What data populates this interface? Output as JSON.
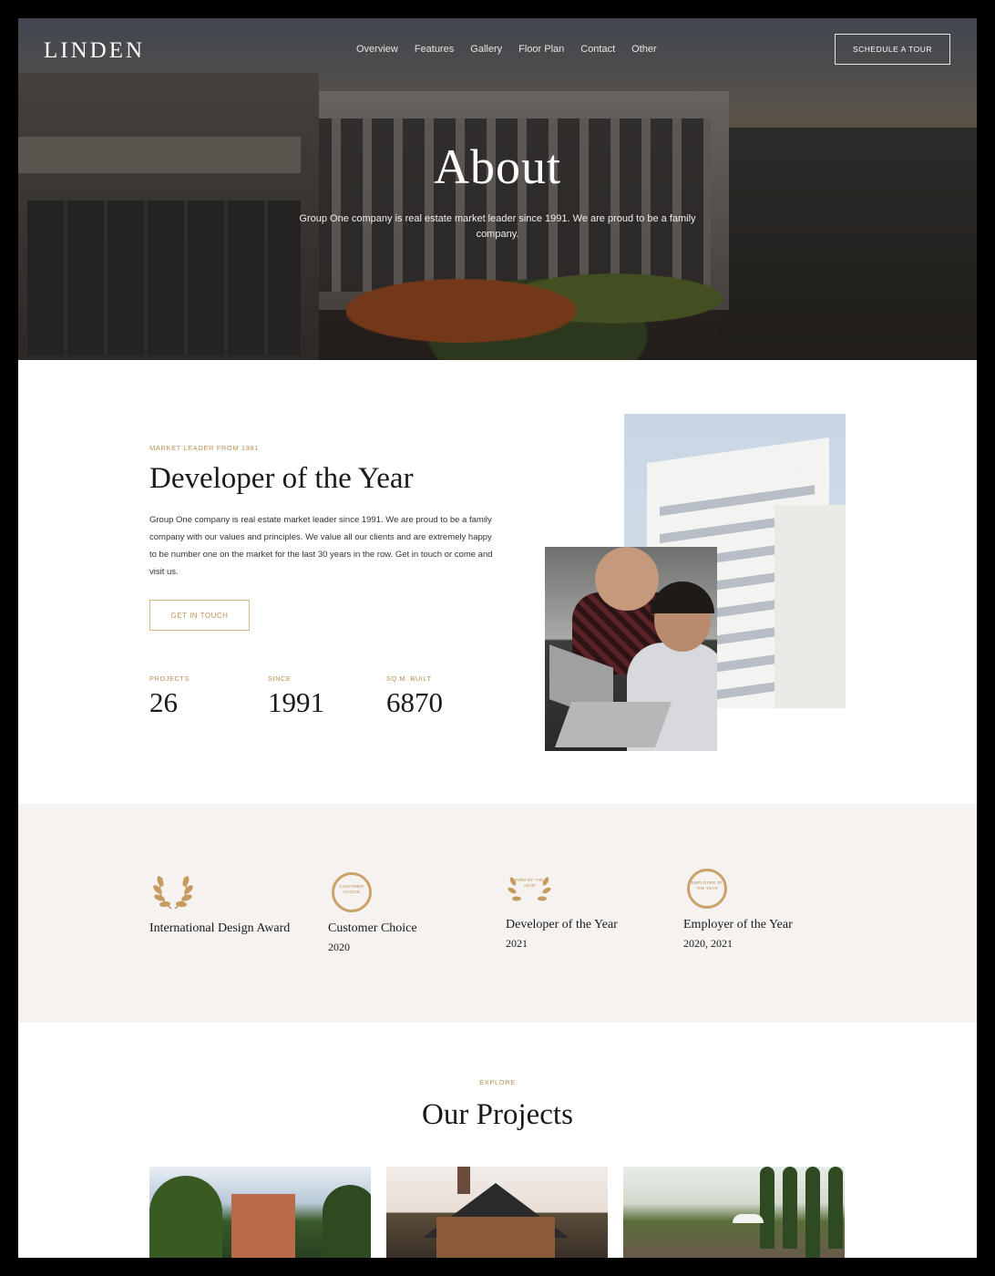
{
  "nav": {
    "logo": "LINDEN",
    "links": [
      "Overview",
      "Features",
      "Gallery",
      "Floor Plan",
      "Contact",
      "Other"
    ],
    "cta": "SCHEDULE A TOUR"
  },
  "hero": {
    "title": "About",
    "subtitle": "Group One company is real estate market leader since 1991. We are proud to be a family company."
  },
  "about": {
    "eyebrow": "MARKET LEADER FROM 1991",
    "title": "Developer of the Year",
    "text": "Group One company is real estate market leader since 1991. We are proud to be a family company with our values and principles. We value all our clients and are extremely happy to be number one on the market for the last 30 years in the row. Get in touch or come and visit us.",
    "button": "GET IN TOUCH",
    "stats": [
      {
        "label": "PROJECTS",
        "value": "26"
      },
      {
        "label": "SINCE",
        "value": "1991"
      },
      {
        "label": "SQ.M. BUILT",
        "value": "6870"
      }
    ]
  },
  "awards": [
    {
      "icon": "laurel-wreath-icon",
      "name": "International Design Award",
      "year": ""
    },
    {
      "icon": "badge-icon",
      "badge": "CUSTOMER CHOICE",
      "name": "Customer Choice",
      "year": "2020"
    },
    {
      "icon": "laurel-badge-icon",
      "badge": "FIRM OF THE YEAR",
      "name": "Developer of the Year",
      "year": "2021"
    },
    {
      "icon": "badge-icon",
      "badge": "EMPLOYER OF THE YEAR",
      "name": "Employer of the Year",
      "year": "2020, 2021"
    }
  ],
  "projects": {
    "eyebrow": "EXPLORE",
    "title": "Our Projects"
  },
  "colors": {
    "accent": "#b89055",
    "beige": "#f5f2ef"
  }
}
